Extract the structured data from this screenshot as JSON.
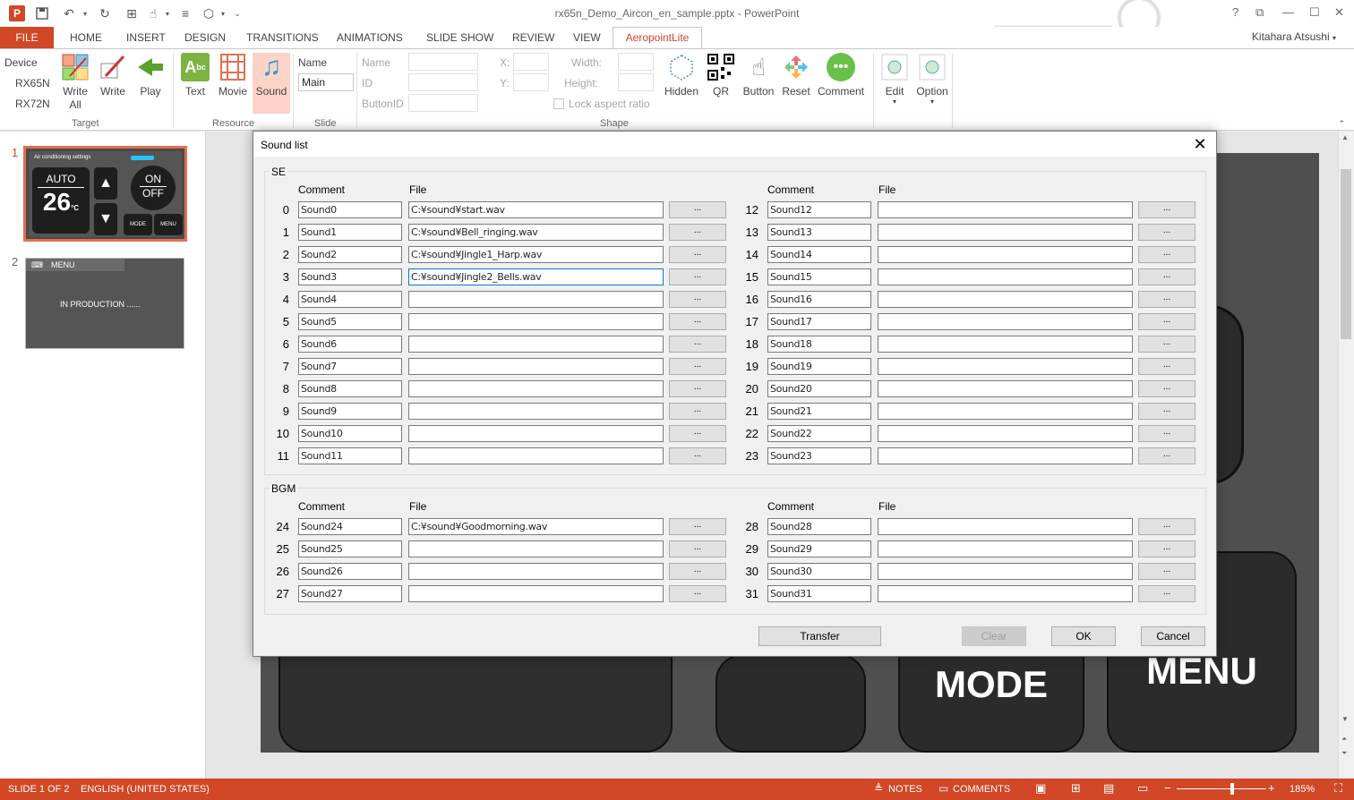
{
  "window": {
    "title": "rx65n_Demo_Aircon_en_sample.pptx - PowerPoint",
    "app_logo": "P",
    "user": "Kitahara Atsushi"
  },
  "ribbon_tabs": [
    {
      "label": "FILE"
    },
    {
      "label": "HOME"
    },
    {
      "label": "INSERT"
    },
    {
      "label": "DESIGN"
    },
    {
      "label": "TRANSITIONS"
    },
    {
      "label": "ANIMATIONS"
    },
    {
      "label": "SLIDE SHOW"
    },
    {
      "label": "REVIEW"
    },
    {
      "label": "VIEW"
    },
    {
      "label": "AeropointLite"
    }
  ],
  "ribbon": {
    "device_label": "Device",
    "device_options": [
      "RX65N",
      "RX72N"
    ],
    "write_all": "Write All",
    "write": "Write",
    "play": "Play",
    "target_group": "Target",
    "text": "Text",
    "movie": "Movie",
    "sound": "Sound",
    "resource_group": "Resource",
    "name_label": "Name",
    "name_value": "Main",
    "slide_group": "Slide",
    "shape_name": "Name",
    "shape_id": "ID",
    "shape_buttonid": "ButtonID",
    "x_label": "X:",
    "y_label": "Y:",
    "width_label": "Width:",
    "height_label": "Height:",
    "lock_aspect": "Lock aspect ratio",
    "shape_group": "Shape",
    "hidden": "Hidden",
    "qr": "QR",
    "button": "Button",
    "reset": "Reset",
    "comment": "Comment",
    "edit": "Edit",
    "option": "Option"
  },
  "slides": [
    {
      "number": "1",
      "header": "Air conditioning settings",
      "auto": "AUTO",
      "temp": "26",
      "unit": "°C",
      "on": "ON",
      "off": "OFF",
      "mode": "MODE",
      "menu": "MENU"
    },
    {
      "number": "2",
      "header": "MENU",
      "body": "IN PRODUCTION ......"
    }
  ],
  "canvas": {
    "mode": "MODE",
    "menu": "MENU"
  },
  "dialog": {
    "title": "Sound list",
    "se_label": "SE",
    "bgm_label": "BGM",
    "comment_header": "Comment",
    "file_header": "File",
    "browse_label": "...",
    "se_left": [
      {
        "num": "0",
        "comment": "Sound0",
        "file": "C:¥sound¥start.wav"
      },
      {
        "num": "1",
        "comment": "Sound1",
        "file": "C:¥sound¥Bell_ringing.wav"
      },
      {
        "num": "2",
        "comment": "Sound2",
        "file": "C:¥sound¥Jingle1_Harp.wav"
      },
      {
        "num": "3",
        "comment": "Sound3",
        "file": "C:¥sound¥Jingle2_Bells.wav"
      },
      {
        "num": "4",
        "comment": "Sound4",
        "file": ""
      },
      {
        "num": "5",
        "comment": "Sound5",
        "file": ""
      },
      {
        "num": "6",
        "comment": "Sound6",
        "file": ""
      },
      {
        "num": "7",
        "comment": "Sound7",
        "file": ""
      },
      {
        "num": "8",
        "comment": "Sound8",
        "file": ""
      },
      {
        "num": "9",
        "comment": "Sound9",
        "file": ""
      },
      {
        "num": "10",
        "comment": "Sound10",
        "file": ""
      },
      {
        "num": "11",
        "comment": "Sound11",
        "file": ""
      }
    ],
    "se_right": [
      {
        "num": "12",
        "comment": "Sound12",
        "file": ""
      },
      {
        "num": "13",
        "comment": "Sound13",
        "file": ""
      },
      {
        "num": "14",
        "comment": "Sound14",
        "file": ""
      },
      {
        "num": "15",
        "comment": "Sound15",
        "file": ""
      },
      {
        "num": "16",
        "comment": "Sound16",
        "file": ""
      },
      {
        "num": "17",
        "comment": "Sound17",
        "file": ""
      },
      {
        "num": "18",
        "comment": "Sound18",
        "file": ""
      },
      {
        "num": "19",
        "comment": "Sound19",
        "file": ""
      },
      {
        "num": "20",
        "comment": "Sound20",
        "file": ""
      },
      {
        "num": "21",
        "comment": "Sound21",
        "file": ""
      },
      {
        "num": "22",
        "comment": "Sound22",
        "file": ""
      },
      {
        "num": "23",
        "comment": "Sound23",
        "file": ""
      }
    ],
    "bgm_left": [
      {
        "num": "24",
        "comment": "Sound24",
        "file": "C:¥sound¥Goodmorning.wav"
      },
      {
        "num": "25",
        "comment": "Sound25",
        "file": ""
      },
      {
        "num": "26",
        "comment": "Sound26",
        "file": ""
      },
      {
        "num": "27",
        "comment": "Sound27",
        "file": ""
      }
    ],
    "bgm_right": [
      {
        "num": "28",
        "comment": "Sound28",
        "file": ""
      },
      {
        "num": "29",
        "comment": "Sound29",
        "file": ""
      },
      {
        "num": "30",
        "comment": "Sound30",
        "file": ""
      },
      {
        "num": "31",
        "comment": "Sound31",
        "file": ""
      }
    ],
    "transfer": "Transfer",
    "clear": "Clear",
    "ok": "OK",
    "cancel": "Cancel"
  },
  "status": {
    "slide": "SLIDE 1 OF 2",
    "language": "ENGLISH (UNITED STATES)",
    "notes": "NOTES",
    "comments": "COMMENTS",
    "zoom": "185%"
  },
  "colors": {
    "accent": "#d24726",
    "focus": "#0078d7"
  }
}
